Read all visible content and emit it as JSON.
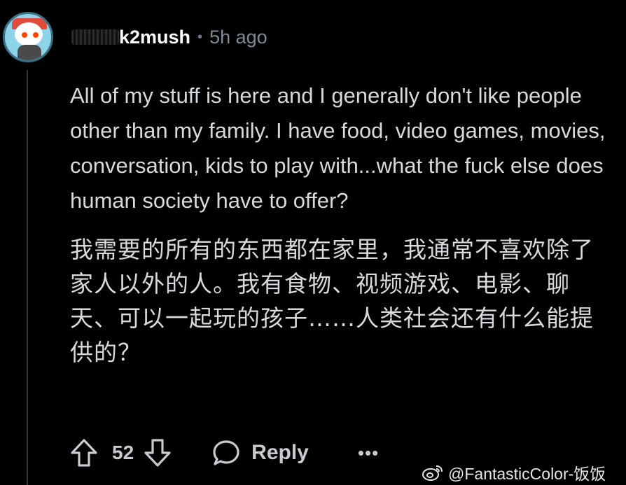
{
  "comment": {
    "username": "k2mush",
    "separator": "•",
    "time": "5h ago",
    "body_en": "All of my stuff is here and I generally don't like people other than my family. I have food, video games, movies, conversation, kids to play with...what the fuck else does human society have to offer?",
    "body_zh": "我需要的所有的东西都在家里，我通常不喜欢除了家人以外的人。我有食物、视频游戏、电影、聊天、可以一起玩的孩子……人类社会还有什么能提供的？"
  },
  "actions": {
    "score": "52",
    "reply_label": "Reply",
    "more_label": "•••"
  },
  "icons": [
    "avatar",
    "upvote-icon",
    "downvote-icon",
    "comment-bubble-icon",
    "more-icon",
    "weibo-icon"
  ],
  "watermark": {
    "text": "@FantasticColor-饭饭"
  },
  "colors": {
    "background": "#000000",
    "text": "#d7dadc",
    "muted": "#7f8c96",
    "thread_line": "#343536"
  }
}
